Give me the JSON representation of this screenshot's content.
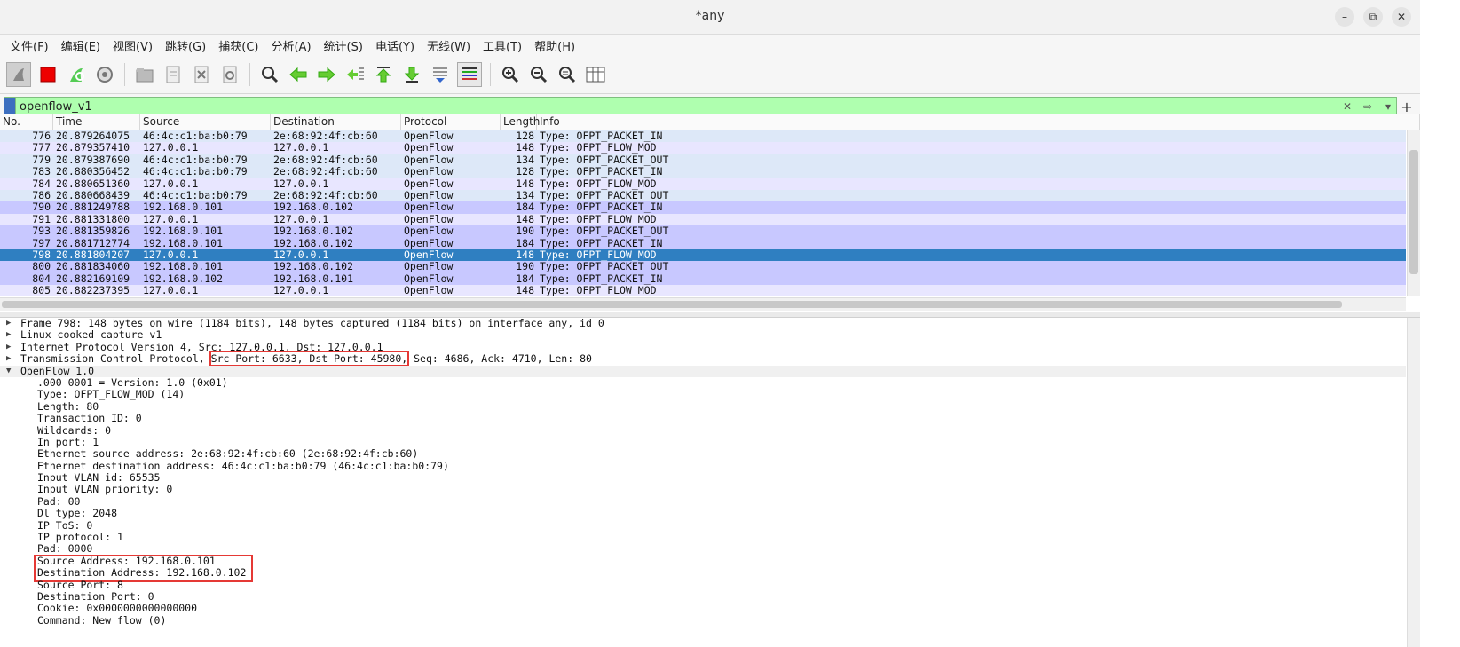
{
  "window": {
    "title": "*any",
    "controls": [
      "–",
      "⧉",
      "✕"
    ]
  },
  "menu": [
    "文件(F)",
    "编辑(E)",
    "视图(V)",
    "跳转(G)",
    "捕获(C)",
    "分析(A)",
    "统计(S)",
    "电话(Y)",
    "无线(W)",
    "工具(T)",
    "帮助(H)"
  ],
  "filter": {
    "value": "openflow_v1",
    "placeholder": ""
  },
  "columns": {
    "no": "No.",
    "time": "Time",
    "source": "Source",
    "destination": "Destination",
    "protocol": "Protocol",
    "length": "Length",
    "info": "Info"
  },
  "packets": [
    {
      "no": "776",
      "time": "20.879264075",
      "src": "46:4c:c1:ba:b0:79",
      "dst": "2e:68:92:4f:cb:60",
      "proto": "OpenFlow",
      "len": "128",
      "info": "Type: OFPT_PACKET_IN",
      "bg": "#dde8f8",
      "fg": "#111"
    },
    {
      "no": "777",
      "time": "20.879357410",
      "src": "127.0.0.1",
      "dst": "127.0.0.1",
      "proto": "OpenFlow",
      "len": "148",
      "info": "Type: OFPT_FLOW_MOD",
      "bg": "#e8e6ff",
      "fg": "#111"
    },
    {
      "no": "779",
      "time": "20.879387690",
      "src": "46:4c:c1:ba:b0:79",
      "dst": "2e:68:92:4f:cb:60",
      "proto": "OpenFlow",
      "len": "134",
      "info": "Type: OFPT_PACKET_OUT",
      "bg": "#dde8f8",
      "fg": "#111"
    },
    {
      "no": "783",
      "time": "20.880356452",
      "src": "46:4c:c1:ba:b0:79",
      "dst": "2e:68:92:4f:cb:60",
      "proto": "OpenFlow",
      "len": "128",
      "info": "Type: OFPT_PACKET_IN",
      "bg": "#dde8f8",
      "fg": "#111"
    },
    {
      "no": "784",
      "time": "20.880651360",
      "src": "127.0.0.1",
      "dst": "127.0.0.1",
      "proto": "OpenFlow",
      "len": "148",
      "info": "Type: OFPT_FLOW_MOD",
      "bg": "#e8e6ff",
      "fg": "#111"
    },
    {
      "no": "786",
      "time": "20.880668439",
      "src": "46:4c:c1:ba:b0:79",
      "dst": "2e:68:92:4f:cb:60",
      "proto": "OpenFlow",
      "len": "134",
      "info": "Type: OFPT_PACKET_OUT",
      "bg": "#dde8f8",
      "fg": "#111"
    },
    {
      "no": "790",
      "time": "20.881249788",
      "src": "192.168.0.101",
      "dst": "192.168.0.102",
      "proto": "OpenFlow",
      "len": "184",
      "info": "Type: OFPT_PACKET_IN",
      "bg": "#c8c8ff",
      "fg": "#111"
    },
    {
      "no": "791",
      "time": "20.881331800",
      "src": "127.0.0.1",
      "dst": "127.0.0.1",
      "proto": "OpenFlow",
      "len": "148",
      "info": "Type: OFPT_FLOW_MOD",
      "bg": "#e8e6ff",
      "fg": "#111"
    },
    {
      "no": "793",
      "time": "20.881359826",
      "src": "192.168.0.101",
      "dst": "192.168.0.102",
      "proto": "OpenFlow",
      "len": "190",
      "info": "Type: OFPT_PACKET_OUT",
      "bg": "#c8c8ff",
      "fg": "#111"
    },
    {
      "no": "797",
      "time": "20.881712774",
      "src": "192.168.0.101",
      "dst": "192.168.0.102",
      "proto": "OpenFlow",
      "len": "184",
      "info": "Type: OFPT_PACKET_IN",
      "bg": "#c8c8ff",
      "fg": "#111"
    },
    {
      "no": "798",
      "time": "20.881804207",
      "src": "127.0.0.1",
      "dst": "127.0.0.1",
      "proto": "OpenFlow",
      "len": "148",
      "info": "Type: OFPT_FLOW_MOD",
      "bg": "#2f7fc1",
      "fg": "#ffffff"
    },
    {
      "no": "800",
      "time": "20.881834060",
      "src": "192.168.0.101",
      "dst": "192.168.0.102",
      "proto": "OpenFlow",
      "len": "190",
      "info": "Type: OFPT_PACKET_OUT",
      "bg": "#c8c8ff",
      "fg": "#111"
    },
    {
      "no": "804",
      "time": "20.882169109",
      "src": "192.168.0.102",
      "dst": "192.168.0.101",
      "proto": "OpenFlow",
      "len": "184",
      "info": "Type: OFPT_PACKET_IN",
      "bg": "#c8c8ff",
      "fg": "#111"
    },
    {
      "no": "805",
      "time": "20.882237395",
      "src": "127.0.0.1",
      "dst": "127.0.0.1",
      "proto": "OpenFlow",
      "len": "148",
      "info": "Type: OFPT_FLOW_MOD",
      "bg": "#e8e6ff",
      "fg": "#111"
    }
  ],
  "details": {
    "frame": "Frame 798: 148 bytes on wire (1184 bits), 148 bytes captured (1184 bits) on interface any, id 0",
    "linux": "Linux cooked capture v1",
    "ip": "Internet Protocol Version 4, Src: 127.0.0.1, Dst: 127.0.0.1",
    "tcp_prefix": "Transmission Control Protocol, ",
    "tcp_ports": "Src Port: 6633, Dst Port: 45980,",
    "tcp_suffix": " Seq: 4686, Ack: 4710, Len: 80",
    "openflow": "OpenFlow 1.0",
    "fields": [
      ".000 0001 = Version: 1.0 (0x01)",
      "Type: OFPT_FLOW_MOD (14)",
      "Length: 80",
      "Transaction ID: 0",
      "Wildcards: 0",
      "In port: 1",
      "Ethernet source address: 2e:68:92:4f:cb:60 (2e:68:92:4f:cb:60)",
      "Ethernet destination address: 46:4c:c1:ba:b0:79 (46:4c:c1:ba:b0:79)",
      "Input VLAN id: 65535",
      "Input VLAN priority: 0",
      "Pad: 00",
      "Dl type: 2048",
      "IP ToS: 0",
      "IP protocol: 1",
      "Pad: 0000"
    ],
    "src_addr": "Source Address: 192.168.0.101",
    "dst_addr": "Destination Address: 192.168.0.102",
    "fields2": [
      "Source Port: 8",
      "Destination Port: 0",
      "Cookie: 0x0000000000000000",
      "Command: New flow (0)"
    ]
  },
  "highlight_color": "#e53935",
  "filter_color": "#afffaf"
}
